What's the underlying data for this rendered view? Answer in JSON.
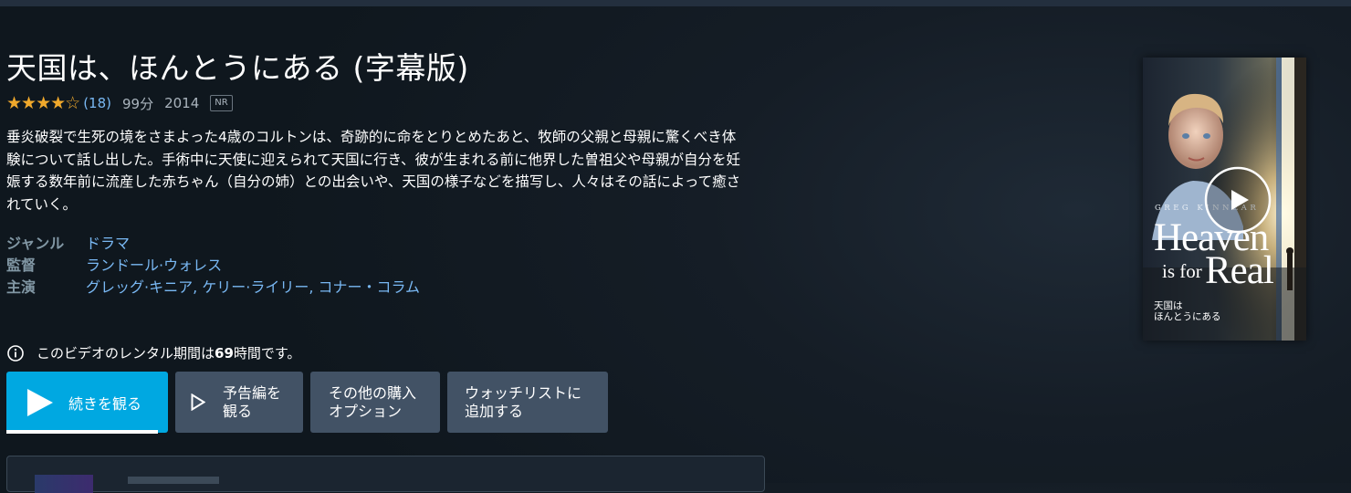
{
  "title": "天国は、ほんとうにある (字幕版)",
  "meta": {
    "stars_filled": "★★★★",
    "stars_empty": "☆",
    "rating_value": 4,
    "rating_max": 5,
    "rating_count": "(18)",
    "runtime": "99分",
    "year": "2014",
    "maturity_badge": "NR"
  },
  "synopsis": "垂炎破裂で生死の境をさまよった4歳のコルトンは、奇跡的に命をとりとめたあと、牧師の父親と母親に驚くべき体験について話し出した。手術中に天使に迎えられて天国に行き、彼が生まれる前に他界した曽祖父や母親が自分を妊娠する数年前に流産した赤ちゃん（自分の姉）との出会いや、天国の様子などを描写し、人々はその話によって癒されていく。",
  "details": {
    "genre_label": "ジャンル",
    "genre_value": "ドラマ",
    "director_label": "監督",
    "director_value": "ランドール·ウォレス",
    "cast_label": "主演",
    "cast_value": "グレッグ·キニア, ケリー·ライリー, コナー・コラム"
  },
  "rental": {
    "icon": "info-icon",
    "prefix": "このビデオのレンタル期間は",
    "hours": "69",
    "suffix": " 時間です。"
  },
  "buttons": {
    "play_label": "続きを観る",
    "trailer_line1": "予告編を",
    "trailer_line2": "観る",
    "more_line1": "その他の購入",
    "more_line2": "オプション",
    "watchlist_line1": "ウォッチリストに",
    "watchlist_line2": "追加する"
  },
  "poster": {
    "actor": "GREG KINNEAR",
    "title_heaven": "Heaven",
    "title_isfor": "is for",
    "title_real": "Real",
    "jp_line1": "天国は",
    "jp_line2": "ほんとうにある"
  },
  "colors": {
    "background": "#0f171e",
    "accent": "#00a8e1",
    "button_gray": "#425265",
    "link": "#79b8f3",
    "star": "#f0a92c"
  }
}
